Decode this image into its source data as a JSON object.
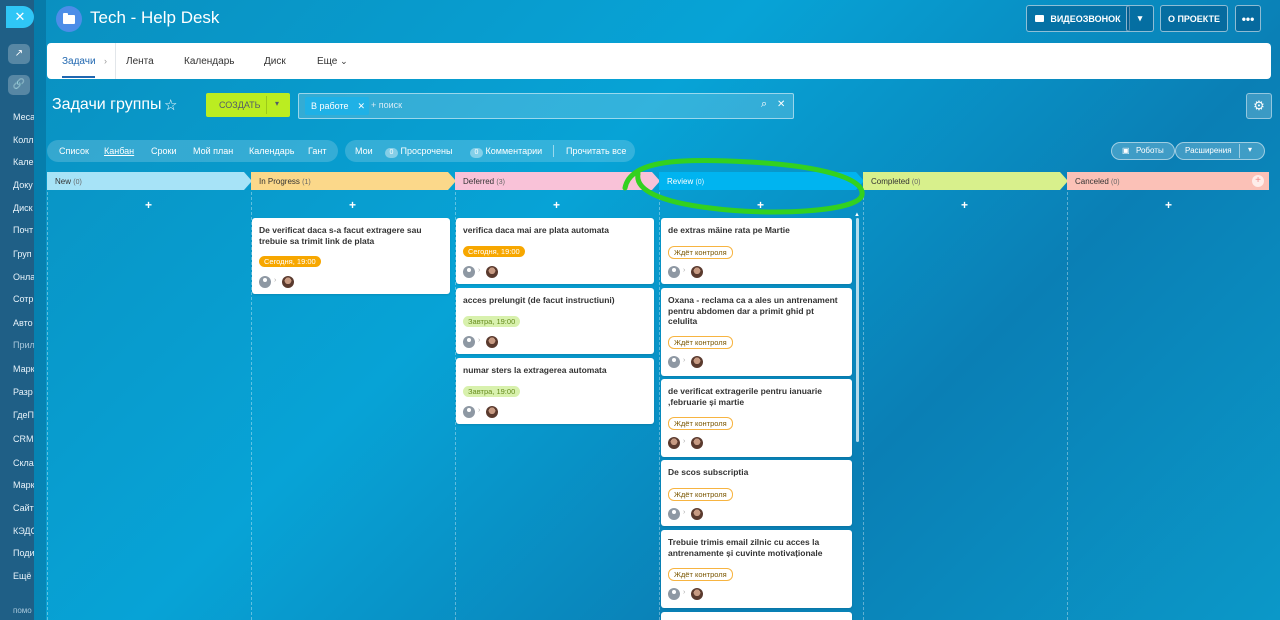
{
  "sidebar": {
    "close_icon": "close-icon",
    "items": [
      "Меса",
      "Колл",
      "Кале",
      "Доку",
      "Диск",
      "Почт",
      "Груп",
      "Онла",
      "Сотр",
      "Авто",
      "Прил",
      "Марк",
      "Разр",
      "ГдеП",
      "CRM",
      "Скла",
      "Марк",
      "Сайт",
      "КЭДО",
      "Поди",
      "Ещё"
    ],
    "footer": "помо"
  },
  "header": {
    "title": "Tech - Help Desk",
    "video_call": "ВИДЕОЗВОНОК",
    "about": "О ПРОЕКТЕ"
  },
  "tabs": [
    "Задачи",
    "Лента",
    "Календарь",
    "Диск",
    "Еще"
  ],
  "toolbar": {
    "page_title": "Задачи группы",
    "create": "СОЗДАТЬ",
    "filter_chip": "В работе",
    "search_placeholder": "+ поиск"
  },
  "views": [
    "Список",
    "Канбан",
    "Сроки",
    "Мой план",
    "Календарь",
    "Гант"
  ],
  "counters": {
    "mine": "Мои",
    "overdue_count": "0",
    "overdue": "Просрочены",
    "comments_count": "0",
    "comments": "Комментарии",
    "read_all": "Прочитать все"
  },
  "right_buttons": {
    "robots": "Роботы",
    "extensions": "Расширения"
  },
  "columns": [
    {
      "name": "New",
      "count": "(0)",
      "color": "#a7e3f7"
    },
    {
      "name": "In Progress",
      "count": "(1)",
      "color": "#fbd88a"
    },
    {
      "name": "Deferred",
      "count": "(3)",
      "color": "#f9c2d8"
    },
    {
      "name": "Review",
      "count": "(0)",
      "color": "#00b4f0"
    },
    {
      "name": "Completed",
      "count": "(0)",
      "color": "#d8f08c"
    },
    {
      "name": "Canceled",
      "count": "(0)",
      "color": "#fbc1b7"
    }
  ],
  "cards": {
    "progress": [
      {
        "title": "De verificat daca s-a facut extragere sau trebuie sa trimit link de plata",
        "badge": "Сегодня, 19:00"
      }
    ],
    "deferred": [
      {
        "title": "verifica daca mai are plata automata",
        "badge": "Сегодня, 19:00"
      },
      {
        "title": "acces prelungit (de facut instructiuni)",
        "badge": "Завтра, 19:00"
      },
      {
        "title": "numar sters la extragerea automata",
        "badge": "Завтра, 19:00"
      }
    ],
    "review": [
      {
        "title": "de extras măine rata pe Martie",
        "badge": "Ждёт контроля"
      },
      {
        "title": "Oxana - reclama ca a ales un antrenament pentru abdomen dar a primit ghid pt celulita",
        "badge": "Ждёт контроля"
      },
      {
        "title": "de verificat extragerile pentru ianuarie ,februarie și martie",
        "badge": "Ждёт контроля"
      },
      {
        "title": "De scos subscriptia",
        "badge": "Ждёт контроля"
      },
      {
        "title": "Trebuie trimis email zilnic cu acces la antrenamente și cuvinte motivaționale",
        "badge": "Ждёт контроля"
      }
    ]
  }
}
